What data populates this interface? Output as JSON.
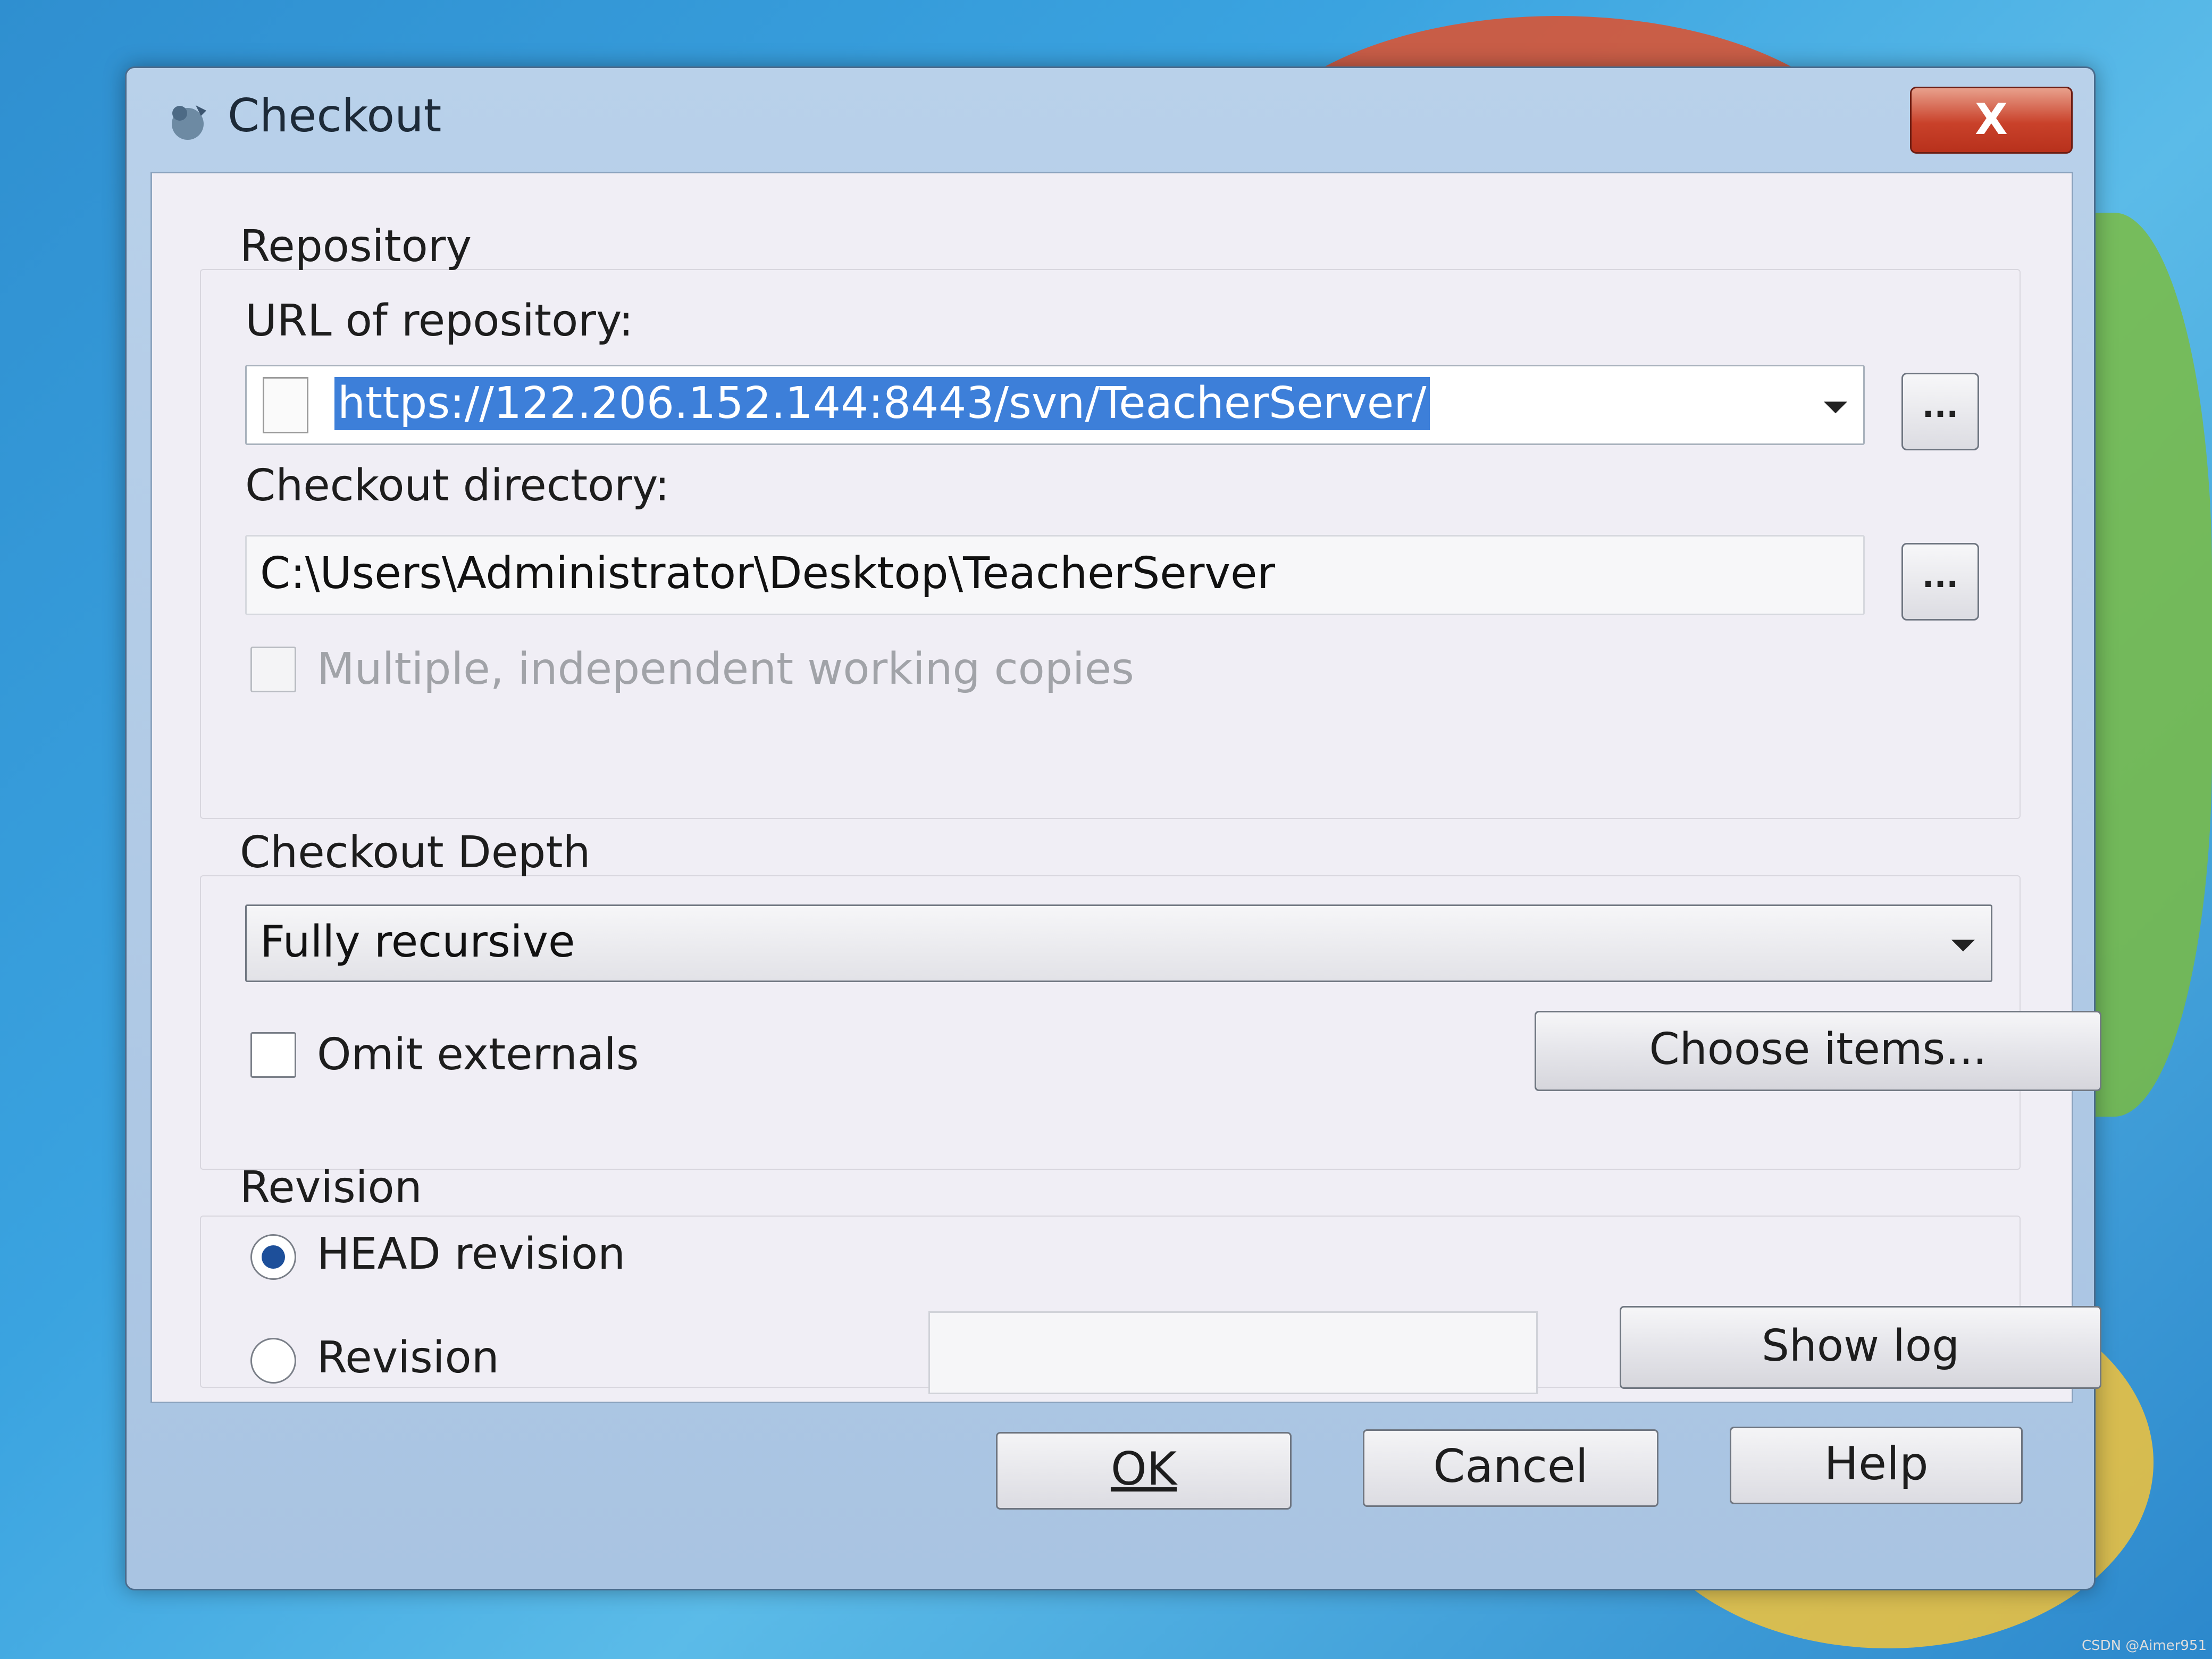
{
  "window": {
    "title": "Checkout",
    "close_label": "X"
  },
  "repository": {
    "group_label": "Repository",
    "url_label": "URL of repository:",
    "url_value": "https://122.206.152.144:8443/svn/TeacherServer/",
    "browse_label": "...",
    "directory_label": "Checkout directory:",
    "directory_value": "C:\\Users\\Administrator\\Desktop\\TeacherServer",
    "multiple_copies_label": "Multiple, independent working copies"
  },
  "depth": {
    "group_label": "Checkout Depth",
    "selected": "Fully recursive",
    "omit_externals_label": "Omit externals",
    "choose_items_label": "Choose items..."
  },
  "revision": {
    "group_label": "Revision",
    "head_label": "HEAD revision",
    "revision_label": "Revision",
    "revision_value": "",
    "show_log_label": "Show log"
  },
  "footer": {
    "ok_label": "OK",
    "cancel_label": "Cancel",
    "help_label": "Help"
  },
  "watermark": "CSDN @Aimer951"
}
